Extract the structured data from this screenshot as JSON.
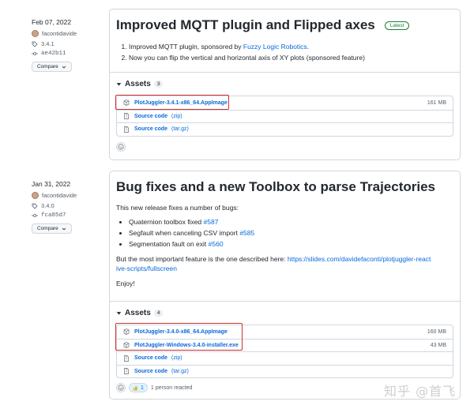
{
  "releases": [
    {
      "date": "Feb 07, 2022",
      "author": "facontidavide",
      "tag": "3.4.1",
      "commit": "ae42b11",
      "compare_label": "Compare",
      "title": "Improved MQTT plugin and Flipped axes",
      "badge": "Latest",
      "notes": [
        {
          "prefix": "Improved MQTT plugin, sponsored by ",
          "link": "Fuzzy Logic Robotics",
          "suffix": "."
        },
        {
          "prefix": "Now you can flip the vertical and horizontal axis of XY plots (sponsored feature)",
          "link": "",
          "suffix": ""
        }
      ],
      "assets_label": "Assets",
      "assets_count": "3",
      "assets": [
        {
          "name": "PlotJuggler-3.4.1-x86_64.AppImage",
          "ext": "",
          "size": "161 MB"
        },
        {
          "name": "Source code",
          "ext": "(zip)",
          "size": ""
        },
        {
          "name": "Source code",
          "ext": "(tar.gz)",
          "size": ""
        }
      ]
    },
    {
      "date": "Jan 31, 2022",
      "author": "facontidavide",
      "tag": "3.4.0",
      "commit": "fca85d7",
      "compare_label": "Compare",
      "title": "Bug fixes and a new Toolbox to parse Trajectories",
      "intro": "This new release fixes a number of bugs:",
      "bullets": [
        {
          "text": "Quaternion toolbox fixed ",
          "link": "#587"
        },
        {
          "text": "Segfault when canceling CSV import ",
          "link": "#585"
        },
        {
          "text": "Segmentation fault on exit ",
          "link": "#560"
        }
      ],
      "feature_prefix": "But the most important feature is the one described here: ",
      "feature_link": "https://slides.com/davidefaconti/plotjuggler-reactive-scripts/fullscreen",
      "enjoy": "Enjoy!",
      "assets_label": "Assets",
      "assets_count": "4",
      "assets": [
        {
          "name": "PlotJuggler-3.4.0-x86_64.AppImage",
          "ext": "",
          "size": "160 MB"
        },
        {
          "name": "PlotJuggler-Windows-3.4.0-installer.exe",
          "ext": "",
          "size": "43 MB"
        },
        {
          "name": "Source code",
          "ext": "(zip)",
          "size": ""
        },
        {
          "name": "Source code",
          "ext": "(tar.gz)",
          "size": ""
        }
      ],
      "reaction_count": "1",
      "reaction_text": "1 person reacted"
    }
  ],
  "watermark": "知乎 @首飞",
  "colors": {
    "link": "#0969da",
    "highlight": "#d0302f",
    "latest": "#1a7f37"
  }
}
